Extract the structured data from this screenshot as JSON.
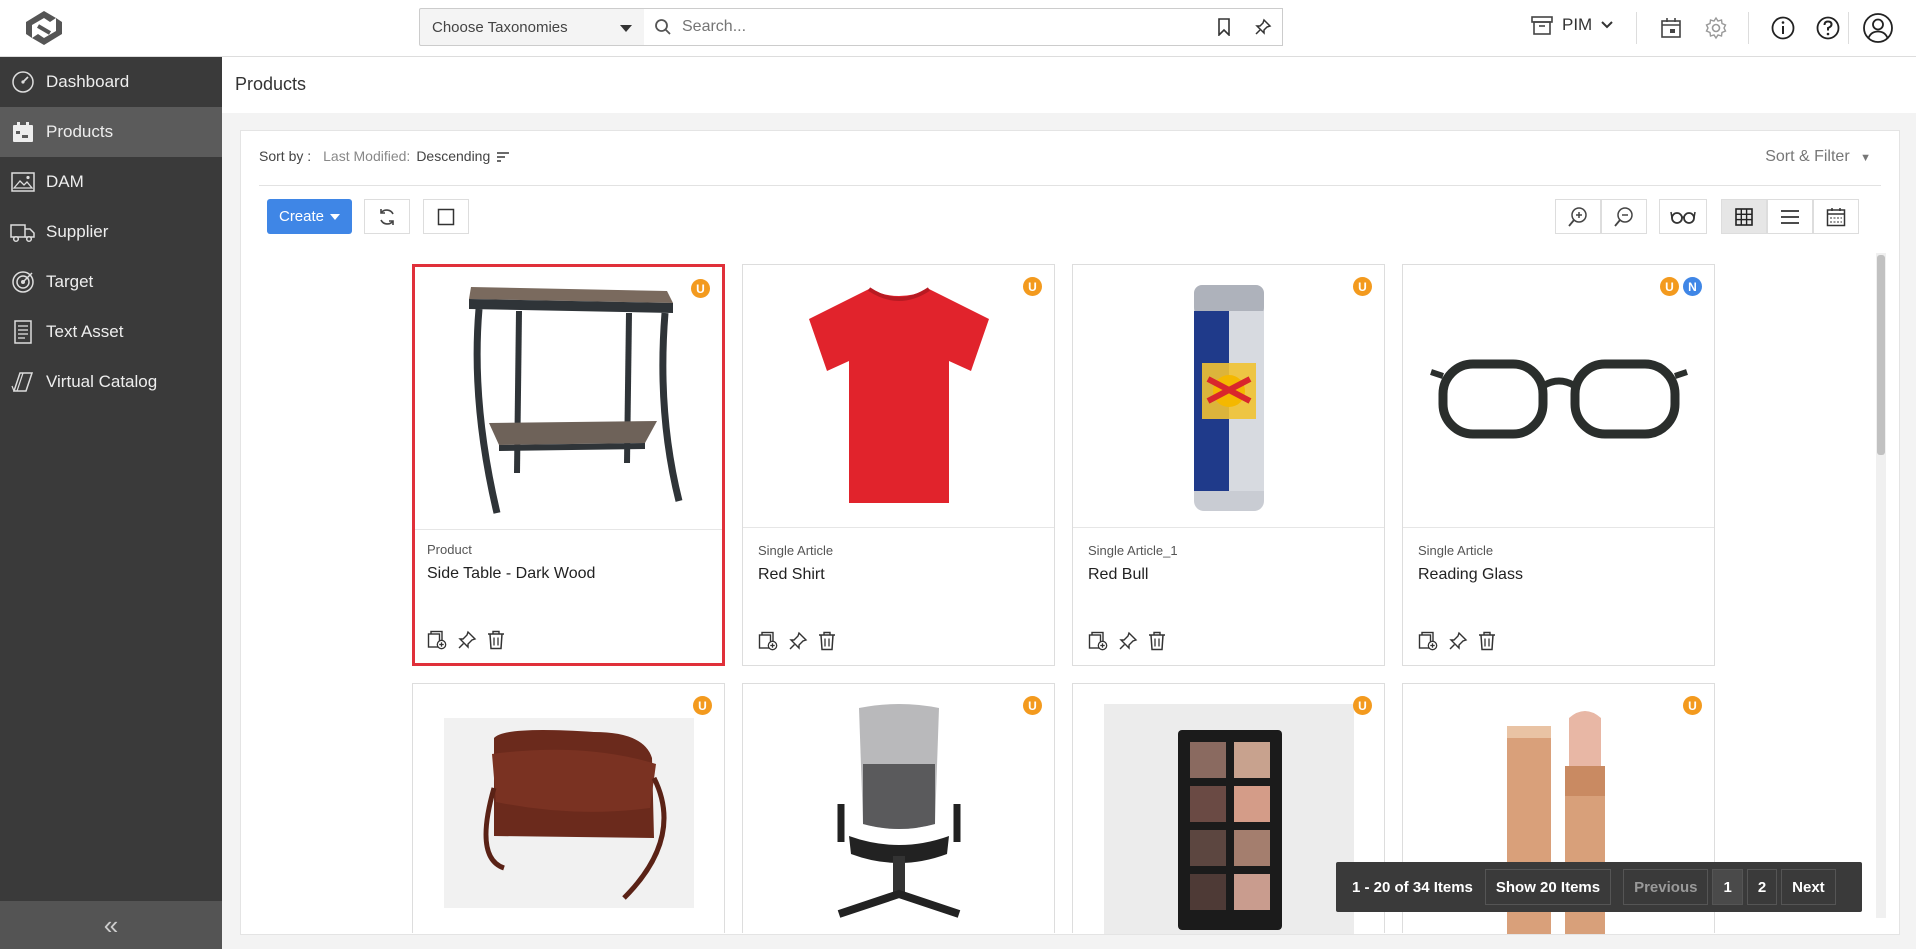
{
  "topbar": {
    "taxonomy_label": "Choose Taxonomies",
    "search_placeholder": "Search...",
    "module": "PIM"
  },
  "sidebar": {
    "items": [
      {
        "label": "Dashboard",
        "icon": "dashboard-icon"
      },
      {
        "label": "Products",
        "icon": "products-icon",
        "active": true
      },
      {
        "label": "DAM",
        "icon": "image-icon"
      },
      {
        "label": "Supplier",
        "icon": "truck-icon"
      },
      {
        "label": "Target",
        "icon": "target-icon"
      },
      {
        "label": "Text Asset",
        "icon": "document-icon"
      },
      {
        "label": "Virtual Catalog",
        "icon": "catalog-icon"
      }
    ],
    "collapse_label": "«"
  },
  "page": {
    "title": "Products"
  },
  "sort": {
    "label": "Sort by :",
    "field": "Last Modified:",
    "direction": "Descending",
    "filter_label": "Sort & Filter"
  },
  "toolbar": {
    "create_label": "Create"
  },
  "products": [
    {
      "type": "Product",
      "name": "Side Table - Dark Wood",
      "badges": [
        "U"
      ],
      "image": "side-table"
    },
    {
      "type": "Single Article",
      "name": "Red Shirt",
      "badges": [
        "U"
      ],
      "image": "red-shirt"
    },
    {
      "type": "Single Article_1",
      "name": "Red Bull",
      "badges": [
        "U"
      ],
      "image": "red-bull-can"
    },
    {
      "type": "Single Article",
      "name": "Reading Glass",
      "badges": [
        "U",
        "N"
      ],
      "image": "glasses"
    },
    {
      "type": "",
      "name": "",
      "badges": [
        "U"
      ],
      "image": "leather-bag"
    },
    {
      "type": "",
      "name": "",
      "badges": [
        "U"
      ],
      "image": "office-chair"
    },
    {
      "type": "",
      "name": "",
      "badges": [
        "U"
      ],
      "image": "eyeshadow-palette"
    },
    {
      "type": "",
      "name": "",
      "badges": [
        "U"
      ],
      "image": "lipstick"
    }
  ],
  "pagination": {
    "count_label": "1 - 20 of 34 Items",
    "show_label": "Show 20 Items",
    "previous_label": "Previous",
    "pages": [
      "1",
      "2"
    ],
    "next_label": "Next"
  },
  "colors": {
    "sidebar": "#3a3a3a",
    "accent": "#3f86e6",
    "badge_u": "#f39a1e",
    "badge_n": "#3f86e6",
    "selected_border": "#e0303a"
  }
}
